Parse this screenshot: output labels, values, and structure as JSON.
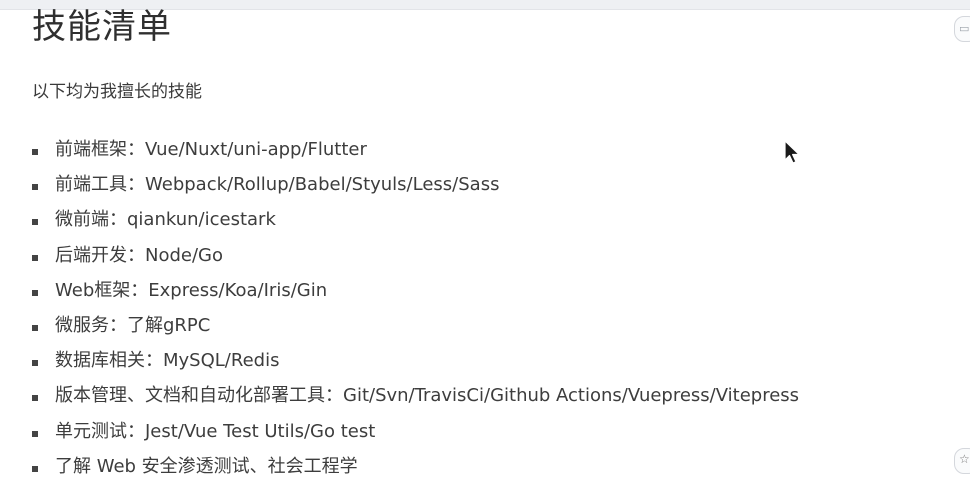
{
  "page": {
    "title": "技能清单",
    "intro": "以下均为我擅长的技能"
  },
  "skills": [
    "前端框架：Vue/Nuxt/uni-app/Flutter",
    "前端工具：Webpack/Rollup/Babel/Styuls/Less/Sass",
    "微前端：qiankun/icestark",
    "后端开发：Node/Go",
    "Web框架：Express/Koa/Iris/Gin",
    "微服务：了解gRPC",
    "数据库相关：MySQL/Redis",
    "版本管理、文档和自动化部署工具：Git/Svn/TravisCi/Github Actions/Vuepress/Vitepress",
    "单元测试：Jest/Vue Test Utils/Go test",
    "了解 Web 安全渗透测试、社会工程学"
  ],
  "icons": {
    "bullet": "square-bullet-icon",
    "cursor": "mouse-pointer-icon",
    "edge_top": "panel-toggle-icon",
    "edge_bottom": "settings-icon"
  }
}
